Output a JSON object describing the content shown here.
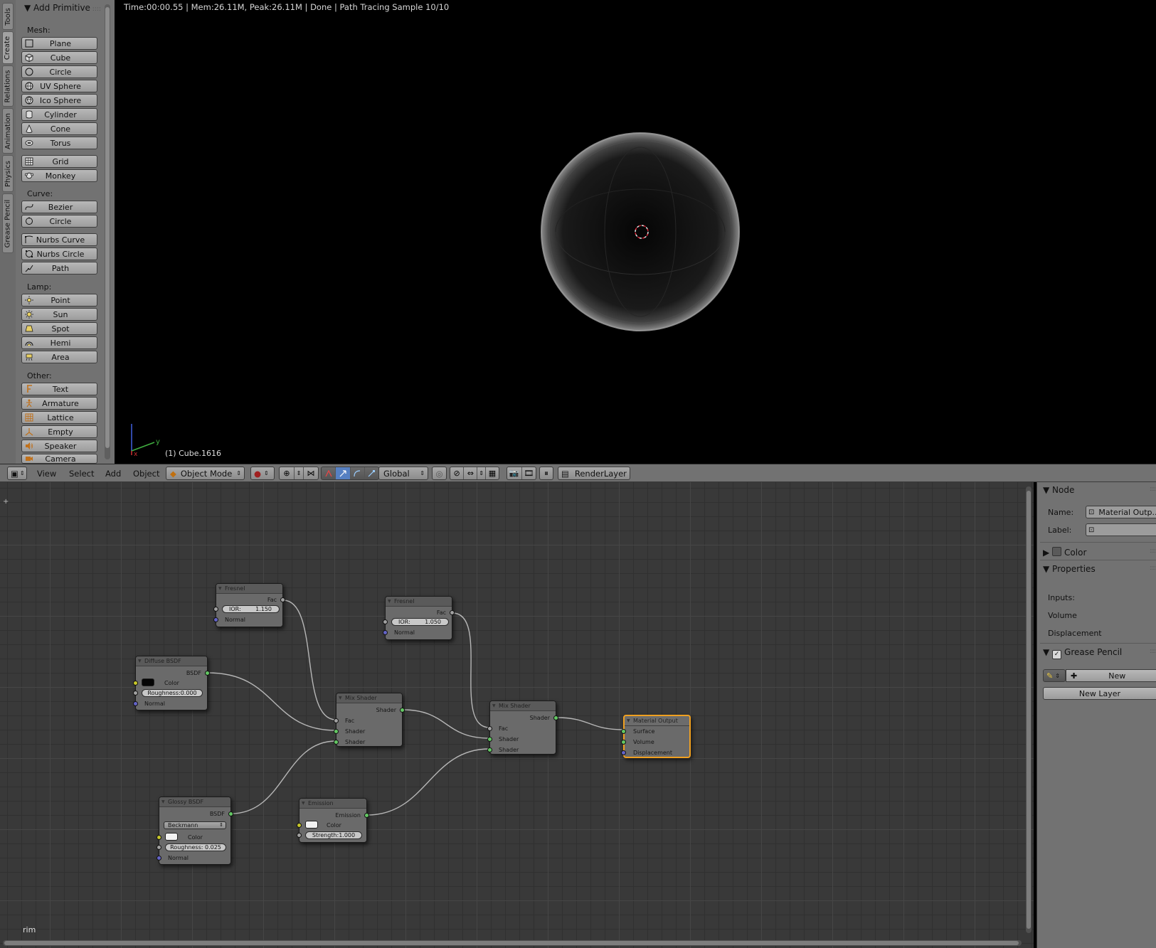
{
  "viewport": {
    "render_status": "Time:00:00.55 | Mem:26.11M, Peak:26.11M | Done | Path Tracing Sample 10/10",
    "object_label": "(1) Cube.1616",
    "axis_x": "x",
    "axis_y": "y"
  },
  "tool_tabs": [
    "Tools",
    "Create",
    "Relations",
    "Animation",
    "Physics",
    "Grease Pencil"
  ],
  "tool_panel": {
    "title": "Add Primitive",
    "mesh_label": "Mesh:",
    "mesh": [
      "Plane",
      "Cube",
      "Circle",
      "UV Sphere",
      "Ico Sphere",
      "Cylinder",
      "Cone",
      "Torus",
      "Grid",
      "Monkey"
    ],
    "curve_label": "Curve:",
    "curve": [
      "Bezier",
      "Circle",
      "Nurbs Curve",
      "Nurbs Circle",
      "Path"
    ],
    "lamp_label": "Lamp:",
    "lamp": [
      "Point",
      "Sun",
      "Spot",
      "Hemi",
      "Area"
    ],
    "other_label": "Other:",
    "other": [
      "Text",
      "Armature",
      "Lattice",
      "Empty",
      "Speaker",
      "Camera"
    ]
  },
  "header": {
    "menus": [
      "View",
      "Select",
      "Add",
      "Object"
    ],
    "mode": "Object Mode",
    "orientation": "Global",
    "render_layer": "RenderLayer"
  },
  "nodes": {
    "fresnel1": {
      "title": "Fresnel",
      "out": "Fac",
      "ior": "IOR:",
      "ior_value": "1.150",
      "normal": "Normal"
    },
    "fresnel2": {
      "title": "Fresnel",
      "out": "Fac",
      "ior": "IOR:",
      "ior_value": "1.050",
      "normal": "Normal"
    },
    "diffuse": {
      "title": "Diffuse BSDF",
      "out": "BSDF",
      "color": "Color",
      "roughness": "Roughness:0.000",
      "normal": "Normal",
      "color_value": "#050505"
    },
    "glossy": {
      "title": "Glossy BSDF",
      "out": "BSDF",
      "dist": "Beckmann",
      "color": "Color",
      "roughness": "Roughness: 0.025",
      "normal": "Normal",
      "color_value": "#f2f2f2"
    },
    "emission": {
      "title": "Emission",
      "out": "Emission",
      "color": "Color",
      "strength": "Strength:1.000",
      "color_value": "#f2f2f2"
    },
    "mix1": {
      "title": "Mix Shader",
      "out": "Shader",
      "fac": "Fac",
      "shader_a": "Shader",
      "shader_b": "Shader"
    },
    "mix2": {
      "title": "Mix Shader",
      "out": "Shader",
      "fac": "Fac",
      "shader_a": "Shader",
      "shader_b": "Shader"
    },
    "output": {
      "title": "Material Output",
      "surface": "Surface",
      "volume": "Volume",
      "displacement": "Displacement"
    }
  },
  "editor_name": "rim",
  "sidebar": {
    "node_head": "Node",
    "name_label": "Name:",
    "name_value": "Material Outp...",
    "label_label": "Label:",
    "label_value": "",
    "color_head": "Color",
    "properties_head": "Properties",
    "inputs_label": "Inputs:",
    "volume_label": "Volume",
    "displacement_label": "Displacement",
    "gp_head": "Grease Pencil",
    "new_label": "New",
    "new_layer_label": "New Layer"
  },
  "colors": {
    "accent_select": "#f0a020",
    "socket_shader": "#63c763",
    "socket_color": "#c7c729",
    "socket_value": "#a1a1a1",
    "socket_vector": "#6363c7",
    "toggle_on": "#5680c2"
  }
}
